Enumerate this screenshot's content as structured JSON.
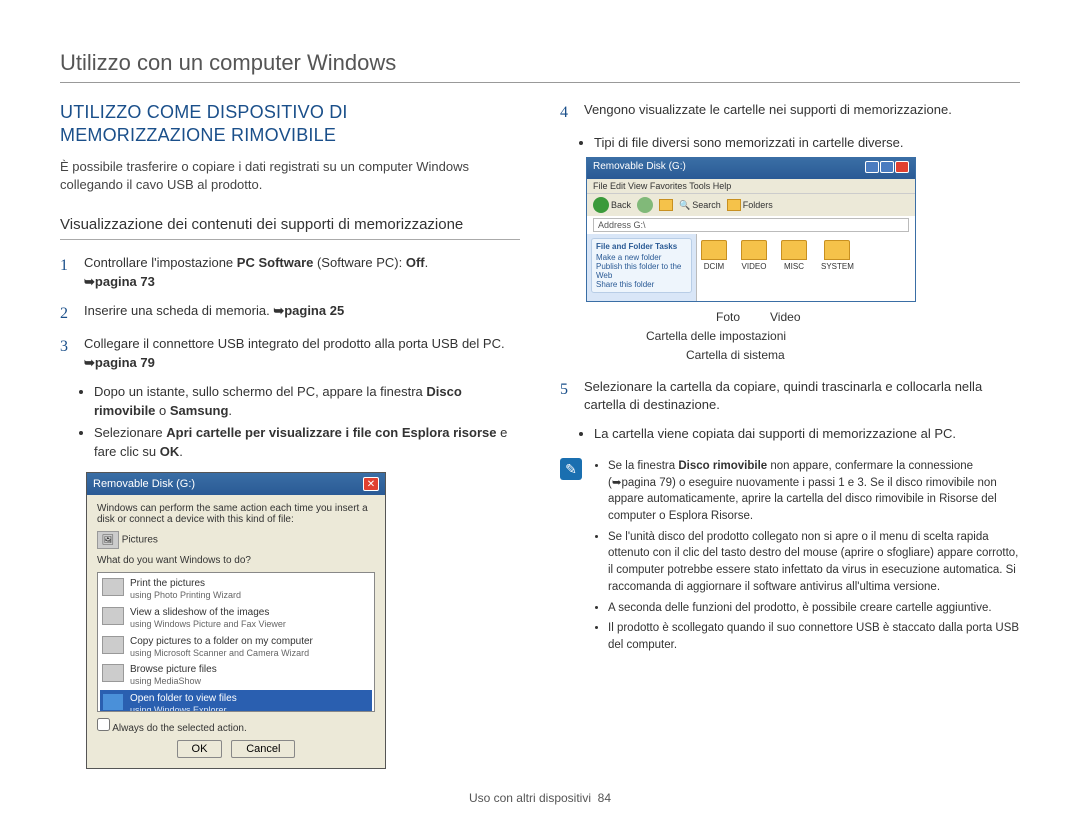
{
  "page_title": "Utilizzo con un computer Windows",
  "section_heading_line1": "UTILIZZO COME DISPOSITIVO DI",
  "section_heading_line2": "MEMORIZZAZIONE RIMOVIBILE",
  "intro": "È possibile trasferire o copiare i dati registrati su un computer Windows collegando il cavo USB al prodotto.",
  "subheading": "Visualizzazione dei contenuti dei supporti di memorizzazione",
  "steps": {
    "1": {
      "num": "1",
      "pre": "Controllare l'impostazione ",
      "b1": "PC Software",
      "mid": " (Software PC): ",
      "b2": "Off",
      "post": ". ",
      "pref": "➥pagina 73"
    },
    "2": {
      "num": "2",
      "text": "Inserire una scheda di memoria. ",
      "pref": "➥pagina 25"
    },
    "3": {
      "num": "3",
      "text": "Collegare il connettore USB integrato del prodotto alla porta USB del PC. ",
      "pref": "➥pagina 79"
    }
  },
  "step3_bullets": {
    "b1_pre": "Dopo un istante, sullo schermo del PC, appare la finestra ",
    "b1_bold": "Disco rimovibile",
    "b1_mid": " o ",
    "b1_bold2": "Samsung",
    "b1_post": ".",
    "b2_pre": "Selezionare ",
    "b2_bold": "Apri cartelle per visualizzare i file con Esplora risorse",
    "b2_mid": " e fare clic su ",
    "b2_bold2": "OK",
    "b2_post": "."
  },
  "dialog": {
    "title": "Removable Disk (G:)",
    "intro": "Windows can perform the same action each time you insert a disk or connect a device with this kind of file:",
    "filetype_label": "Pictures",
    "prompt": "What do you want Windows to do?",
    "items": [
      {
        "main": "Print the pictures",
        "sub": "using Photo Printing Wizard"
      },
      {
        "main": "View a slideshow of the images",
        "sub": "using Windows Picture and Fax Viewer"
      },
      {
        "main": "Copy pictures to a folder on my computer",
        "sub": "using Microsoft Scanner and Camera Wizard"
      },
      {
        "main": "Browse picture files",
        "sub": "using MediaShow"
      },
      {
        "main": "Open folder to view files",
        "sub": "using Windows Explorer"
      }
    ],
    "checkbox": "Always do the selected action.",
    "ok": "OK",
    "cancel": "Cancel"
  },
  "right": {
    "step4": {
      "num": "4",
      "text": "Vengono visualizzate le cartelle nei supporti di memorizzazione."
    },
    "step4_b1": "Tipi di file diversi sono memorizzati in cartelle diverse.",
    "explorer": {
      "title": "Removable Disk (G:)",
      "menu": "File   Edit   View   Favorites   Tools   Help",
      "back": "Back",
      "search": "Search",
      "folders_btn": "Folders",
      "addr": "Address  G:\\",
      "side_panel1_title": "File and Folder Tasks",
      "side_panel1_i1": "Make a new folder",
      "side_panel1_i2": "Publish this folder to the Web",
      "side_panel1_i3": "Share this folder",
      "folders": [
        "DCIM",
        "VIDEO",
        "MISC",
        "SYSTEM"
      ]
    },
    "callouts": {
      "foto": "Foto",
      "video": "Video",
      "settings": "Cartella delle impostazioni",
      "system": "Cartella di sistema"
    },
    "step5": {
      "num": "5",
      "text": "Selezionare la cartella da copiare, quindi trascinarla e collocarla nella cartella di destinazione."
    },
    "step5_b1": "La cartella viene copiata dai supporti di memorizzazione al PC."
  },
  "notes": [
    {
      "pre": "Se la finestra ",
      "bold": "Disco rimovibile",
      "post": " non appare, confermare la connessione (➥pagina 79) o eseguire nuovamente i passi 1 e 3. Se il disco rimovibile non appare automaticamente, aprire la cartella del disco rimovibile in Risorse del computer o Esplora Risorse."
    },
    {
      "text": "Se l'unità disco del prodotto collegato non si apre o il menu di scelta rapida ottenuto con il clic del tasto destro del mouse (aprire o sfogliare) appare corrotto, il computer potrebbe essere stato infettato da virus in esecuzione automatica. Si raccomanda di aggiornare il software antivirus all'ultima versione."
    },
    {
      "text": "A seconda delle funzioni del prodotto, è possibile creare cartelle aggiuntive."
    },
    {
      "text": "Il prodotto è scollegato quando il suo connettore USB è staccato dalla porta USB del computer."
    }
  ],
  "footer": {
    "section": "Uso con altri dispositivi",
    "page": "84"
  }
}
